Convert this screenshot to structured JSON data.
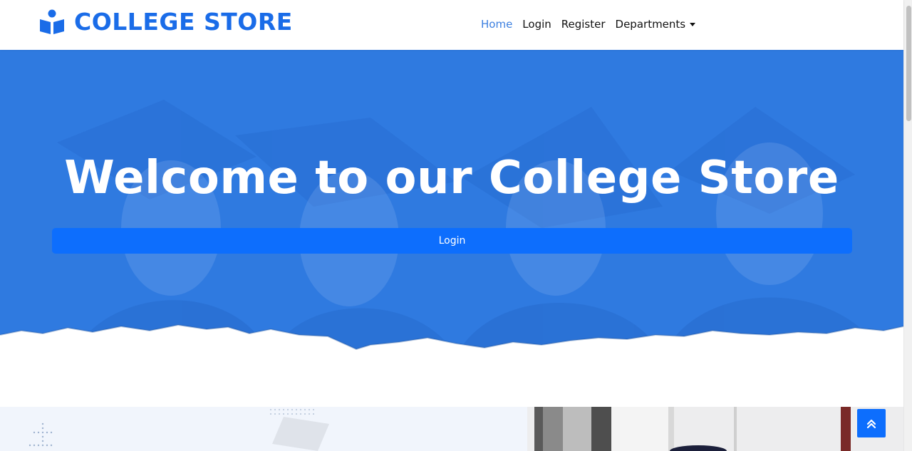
{
  "brand": {
    "name": "COLLEGE STORE",
    "icon": "reading-person-icon",
    "color": "#1a6ce8"
  },
  "nav": {
    "items": [
      {
        "label": "Home",
        "active": true
      },
      {
        "label": "Login",
        "active": false
      },
      {
        "label": "Register",
        "active": false
      },
      {
        "label": "Departments",
        "active": false,
        "dropdown": true
      }
    ]
  },
  "hero": {
    "title": "Welcome to our College Store",
    "button_label": "Login",
    "overlay_color": "#2f7ae0",
    "button_color": "#0d6efd"
  },
  "back_to_top": {
    "icon": "double-chevron-up-icon"
  }
}
